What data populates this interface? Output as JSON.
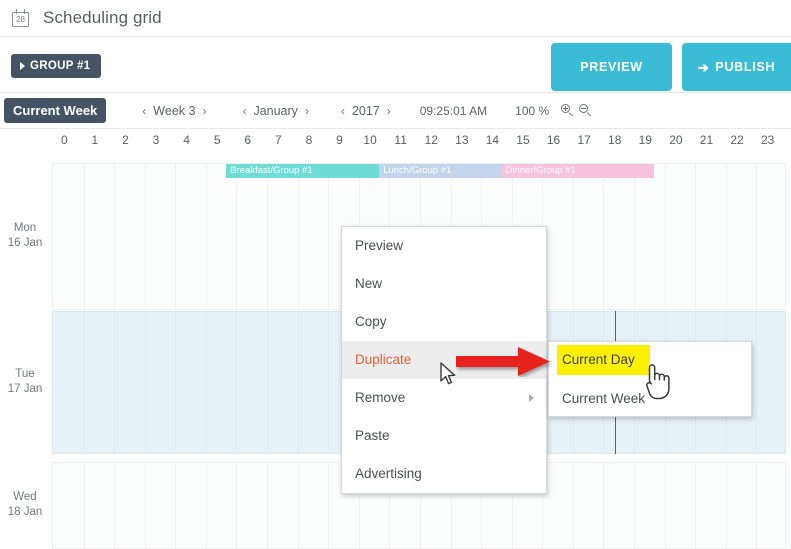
{
  "header": {
    "title": "Scheduling grid",
    "icon": "calendar-icon",
    "icon_number": "28"
  },
  "toolbar": {
    "group_button": "GROUP #1",
    "preview_button": "PREVIEW",
    "publish_button": "PUBLISH",
    "publish_icon": "➔",
    "accent_color": "#3bbcd6",
    "dark_color": "#465365"
  },
  "navbar": {
    "current_week_button": "Current Week",
    "prev_glyph": "‹",
    "next_glyph": "›",
    "week_label": "Week 3",
    "month_label": "January",
    "year_label": "2017",
    "time": "09:25:01 AM",
    "zoom": "100 %",
    "zoom_in_icon": "zoom-in-icon",
    "zoom_out_icon": "zoom-out-icon"
  },
  "ruler": {
    "hours": [
      "0",
      "1",
      "2",
      "3",
      "4",
      "5",
      "6",
      "7",
      "8",
      "9",
      "10",
      "11",
      "12",
      "13",
      "14",
      "15",
      "16",
      "17",
      "18",
      "19",
      "20",
      "21",
      "22",
      "23"
    ]
  },
  "grid": {
    "days": [
      {
        "weekday": "Mon",
        "date": "16 Jan",
        "selected": false
      },
      {
        "weekday": "Tue",
        "date": "17 Jan",
        "selected": true
      },
      {
        "weekday": "Wed",
        "date": "18 Jan",
        "selected": false
      }
    ],
    "events": [
      {
        "label": "Breakfast/Group #1",
        "color": "#6fdcd7",
        "start_hour": 5.7,
        "end_hour": 10.7,
        "day": 0
      },
      {
        "label": "Lunch/Group #1",
        "color": "#c3d4ec",
        "start_hour": 10.7,
        "end_hour": 14.7,
        "day": 0
      },
      {
        "label": "Dinner/Group #1",
        "color": "#f7c3dd",
        "start_hour": 14.7,
        "end_hour": 19.7,
        "day": 0
      }
    ],
    "marker_color": "#c0392b",
    "marker_hour": 18.4
  },
  "context_menu": {
    "items": [
      {
        "label": "Preview",
        "active": false,
        "has_submenu": false
      },
      {
        "label": "New",
        "active": false,
        "has_submenu": false
      },
      {
        "label": "Copy",
        "active": false,
        "has_submenu": false
      },
      {
        "label": "Duplicate",
        "active": true,
        "has_submenu": false
      },
      {
        "label": "Remove",
        "active": false,
        "has_submenu": true
      },
      {
        "label": "Paste",
        "active": false,
        "has_submenu": false
      },
      {
        "label": "Advertising",
        "active": false,
        "has_submenu": false
      }
    ]
  },
  "submenu": {
    "items": [
      {
        "label": "Current Day",
        "highlighted": true
      },
      {
        "label": "Current Week",
        "highlighted": false
      }
    ],
    "highlight_color": "#ffef00"
  },
  "annotation": {
    "arrow_color": "#e8241c",
    "arrow_name": "red-arrow-annotation"
  }
}
